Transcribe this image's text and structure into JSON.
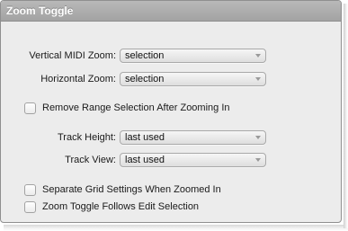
{
  "panel": {
    "title": "Zoom Toggle"
  },
  "fields": {
    "vertical_midi_zoom": {
      "label": "Vertical MIDI Zoom:",
      "value": "selection"
    },
    "horizontal_zoom": {
      "label": "Horizontal Zoom:",
      "value": "selection"
    },
    "track_height": {
      "label": "Track Height:",
      "value": "last used"
    },
    "track_view": {
      "label": "Track View:",
      "value": "last used"
    }
  },
  "checkboxes": {
    "remove_range_selection": {
      "label": "Remove Range Selection After Zooming In",
      "checked": false
    },
    "separate_grid_settings": {
      "label": "Separate Grid Settings When Zoomed In",
      "checked": false
    },
    "follows_edit_selection": {
      "label": "Zoom Toggle Follows Edit Selection",
      "checked": false
    }
  },
  "colors": {
    "header_background": "#a9a9a9",
    "panel_background": "#ececec"
  },
  "icons": {
    "dropdown": "chevron-down-icon"
  }
}
